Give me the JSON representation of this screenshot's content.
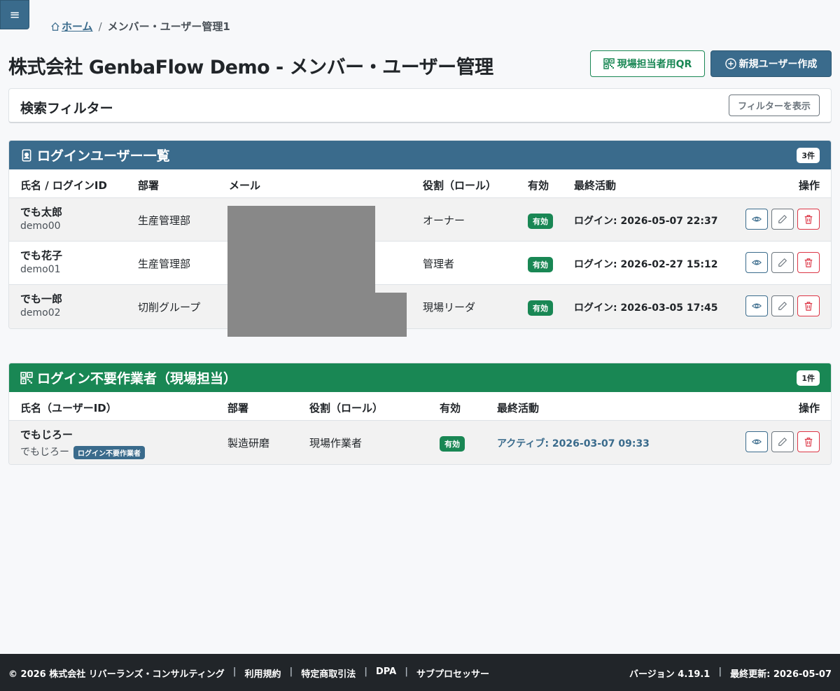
{
  "menu": {
    "icon": "hamburger-icon",
    "label": "≡"
  },
  "breadcrumb": {
    "home": "ホーム",
    "separator": "/",
    "current": "メンバー・ユーザー管理1"
  },
  "page": {
    "title": "株式会社 GenbaFlow Demo - メンバー・ユーザー管理"
  },
  "actions": {
    "qr_label": "現場担当者用QR",
    "new_user_label": "新規ユーザー作成"
  },
  "filter": {
    "title": "検索フィルター",
    "toggle_label": "フィルターを表示"
  },
  "login_users": {
    "title": "ログインユーザー一覧",
    "count": "3件",
    "columns": {
      "name": "氏名 / ログインID",
      "dept": "部署",
      "mail": "メール",
      "role": "役割（ロール）",
      "valid": "有効",
      "last": "最終活動",
      "ops": "操作"
    },
    "rows": [
      {
        "name": "でも太郎",
        "login_id": "demo00",
        "dept": "生産管理部",
        "role": "オーナー",
        "valid": "有効",
        "last": "ログイン: 2026-05-07 22:37"
      },
      {
        "name": "でも花子",
        "login_id": "demo01",
        "dept": "生産管理部",
        "role": "管理者",
        "valid": "有効",
        "last": "ログイン: 2026-02-27 15:12"
      },
      {
        "name": "でも一郎",
        "login_id": "demo02",
        "dept": "切削グループ",
        "role": "現場リーダ",
        "valid": "有効",
        "last": "ログイン: 2026-03-05 17:45"
      }
    ]
  },
  "field_workers": {
    "title": "ログイン不要作業者（現場担当）",
    "count": "1件",
    "columns": {
      "name": "氏名（ユーザーID）",
      "dept": "部署",
      "role": "役割（ロール）",
      "valid": "有効",
      "last": "最終活動",
      "ops": "操作"
    },
    "rows": [
      {
        "name": "でもじろー",
        "user_id": "でもじろー",
        "tag": "ログイン不要作業者",
        "dept": "製造研磨",
        "role": "現場作業者",
        "valid": "有効",
        "last": "アクティブ: 2026-03-07 09:33"
      }
    ]
  },
  "footer": {
    "copyright": "© 2026 株式会社 リバーランズ・コンサルティング",
    "links": [
      "利用規約",
      "特定商取引法",
      "DPA",
      "サブプロセッサー"
    ],
    "version": "バージョン 4.19.1",
    "updated": "最終更新: 2026-05-07"
  },
  "colors": {
    "primary": "#3a6b8c",
    "success": "#198754",
    "danger": "#dc3545",
    "footer": "#212529"
  }
}
